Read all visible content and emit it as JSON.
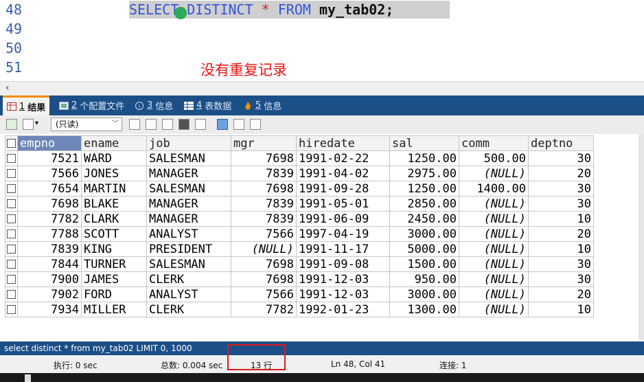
{
  "editor": {
    "line_numbers": [
      "48",
      "49",
      "50",
      "51"
    ],
    "code": {
      "kw_select": "SELECT",
      "kw_distinct": "DISTINCT",
      "star": "*",
      "kw_from": "FROM",
      "table": "my_tab02",
      "semicolon": ";"
    },
    "annotation": "没有重复记录"
  },
  "tabs": [
    {
      "num": "1",
      "label": "结果",
      "icon": "grid-icon",
      "active": true
    },
    {
      "num": "2",
      "label": "个配置文件",
      "icon": "profile-icon",
      "active": false
    },
    {
      "num": "3",
      "label": "信息",
      "icon": "info-icon",
      "active": false
    },
    {
      "num": "4",
      "label": "表数据",
      "icon": "table-icon",
      "active": false
    },
    {
      "num": "5",
      "label": "信息",
      "icon": "flame-icon",
      "active": false
    }
  ],
  "toolbar": {
    "mode_select": "(只读)"
  },
  "grid": {
    "columns": [
      "empno",
      "ename",
      "job",
      "mgr",
      "hiredate",
      "sal",
      "comm",
      "deptno"
    ],
    "rows": [
      [
        "7521",
        "WARD",
        "SALESMAN",
        "7698",
        "1991-02-22",
        "1250.00",
        "500.00",
        "30"
      ],
      [
        "7566",
        "JONES",
        "MANAGER",
        "7839",
        "1991-04-02",
        "2975.00",
        "(NULL)",
        "20"
      ],
      [
        "7654",
        "MARTIN",
        "SALESMAN",
        "7698",
        "1991-09-28",
        "1250.00",
        "1400.00",
        "30"
      ],
      [
        "7698",
        "BLAKE",
        "MANAGER",
        "7839",
        "1991-05-01",
        "2850.00",
        "(NULL)",
        "30"
      ],
      [
        "7782",
        "CLARK",
        "MANAGER",
        "7839",
        "1991-06-09",
        "2450.00",
        "(NULL)",
        "10"
      ],
      [
        "7788",
        "SCOTT",
        "ANALYST",
        "7566",
        "1997-04-19",
        "3000.00",
        "(NULL)",
        "20"
      ],
      [
        "7839",
        "KING",
        "PRESIDENT",
        "(NULL)",
        "1991-11-17",
        "5000.00",
        "(NULL)",
        "10"
      ],
      [
        "7844",
        "TURNER",
        "SALESMAN",
        "7698",
        "1991-09-08",
        "1500.00",
        "(NULL)",
        "30"
      ],
      [
        "7900",
        "JAMES",
        "CLERK",
        "7698",
        "1991-12-03",
        "950.00",
        "(NULL)",
        "30"
      ],
      [
        "7902",
        "FORD",
        "ANALYST",
        "7566",
        "1991-12-03",
        "3000.00",
        "(NULL)",
        "20"
      ],
      [
        "7934",
        "MILLER",
        "CLERK",
        "7782",
        "1992-01-23",
        "1300.00",
        "(NULL)",
        "10"
      ]
    ]
  },
  "sql_status": "select distinct * from my_tab02 LIMIT 0, 1000",
  "status": {
    "exec_time": "执行: 0 sec",
    "total_time": "总数: 0.004 sec",
    "rows": "13 行",
    "position": "Ln 48, Col 41",
    "connection": "连接: 1"
  },
  "colors": {
    "accent": "#1c4f87",
    "tab_active_marker": "#f08c00",
    "highlight_box": "#e01919",
    "keyword": "#3355dd",
    "selected_header": "#6e86b8"
  }
}
